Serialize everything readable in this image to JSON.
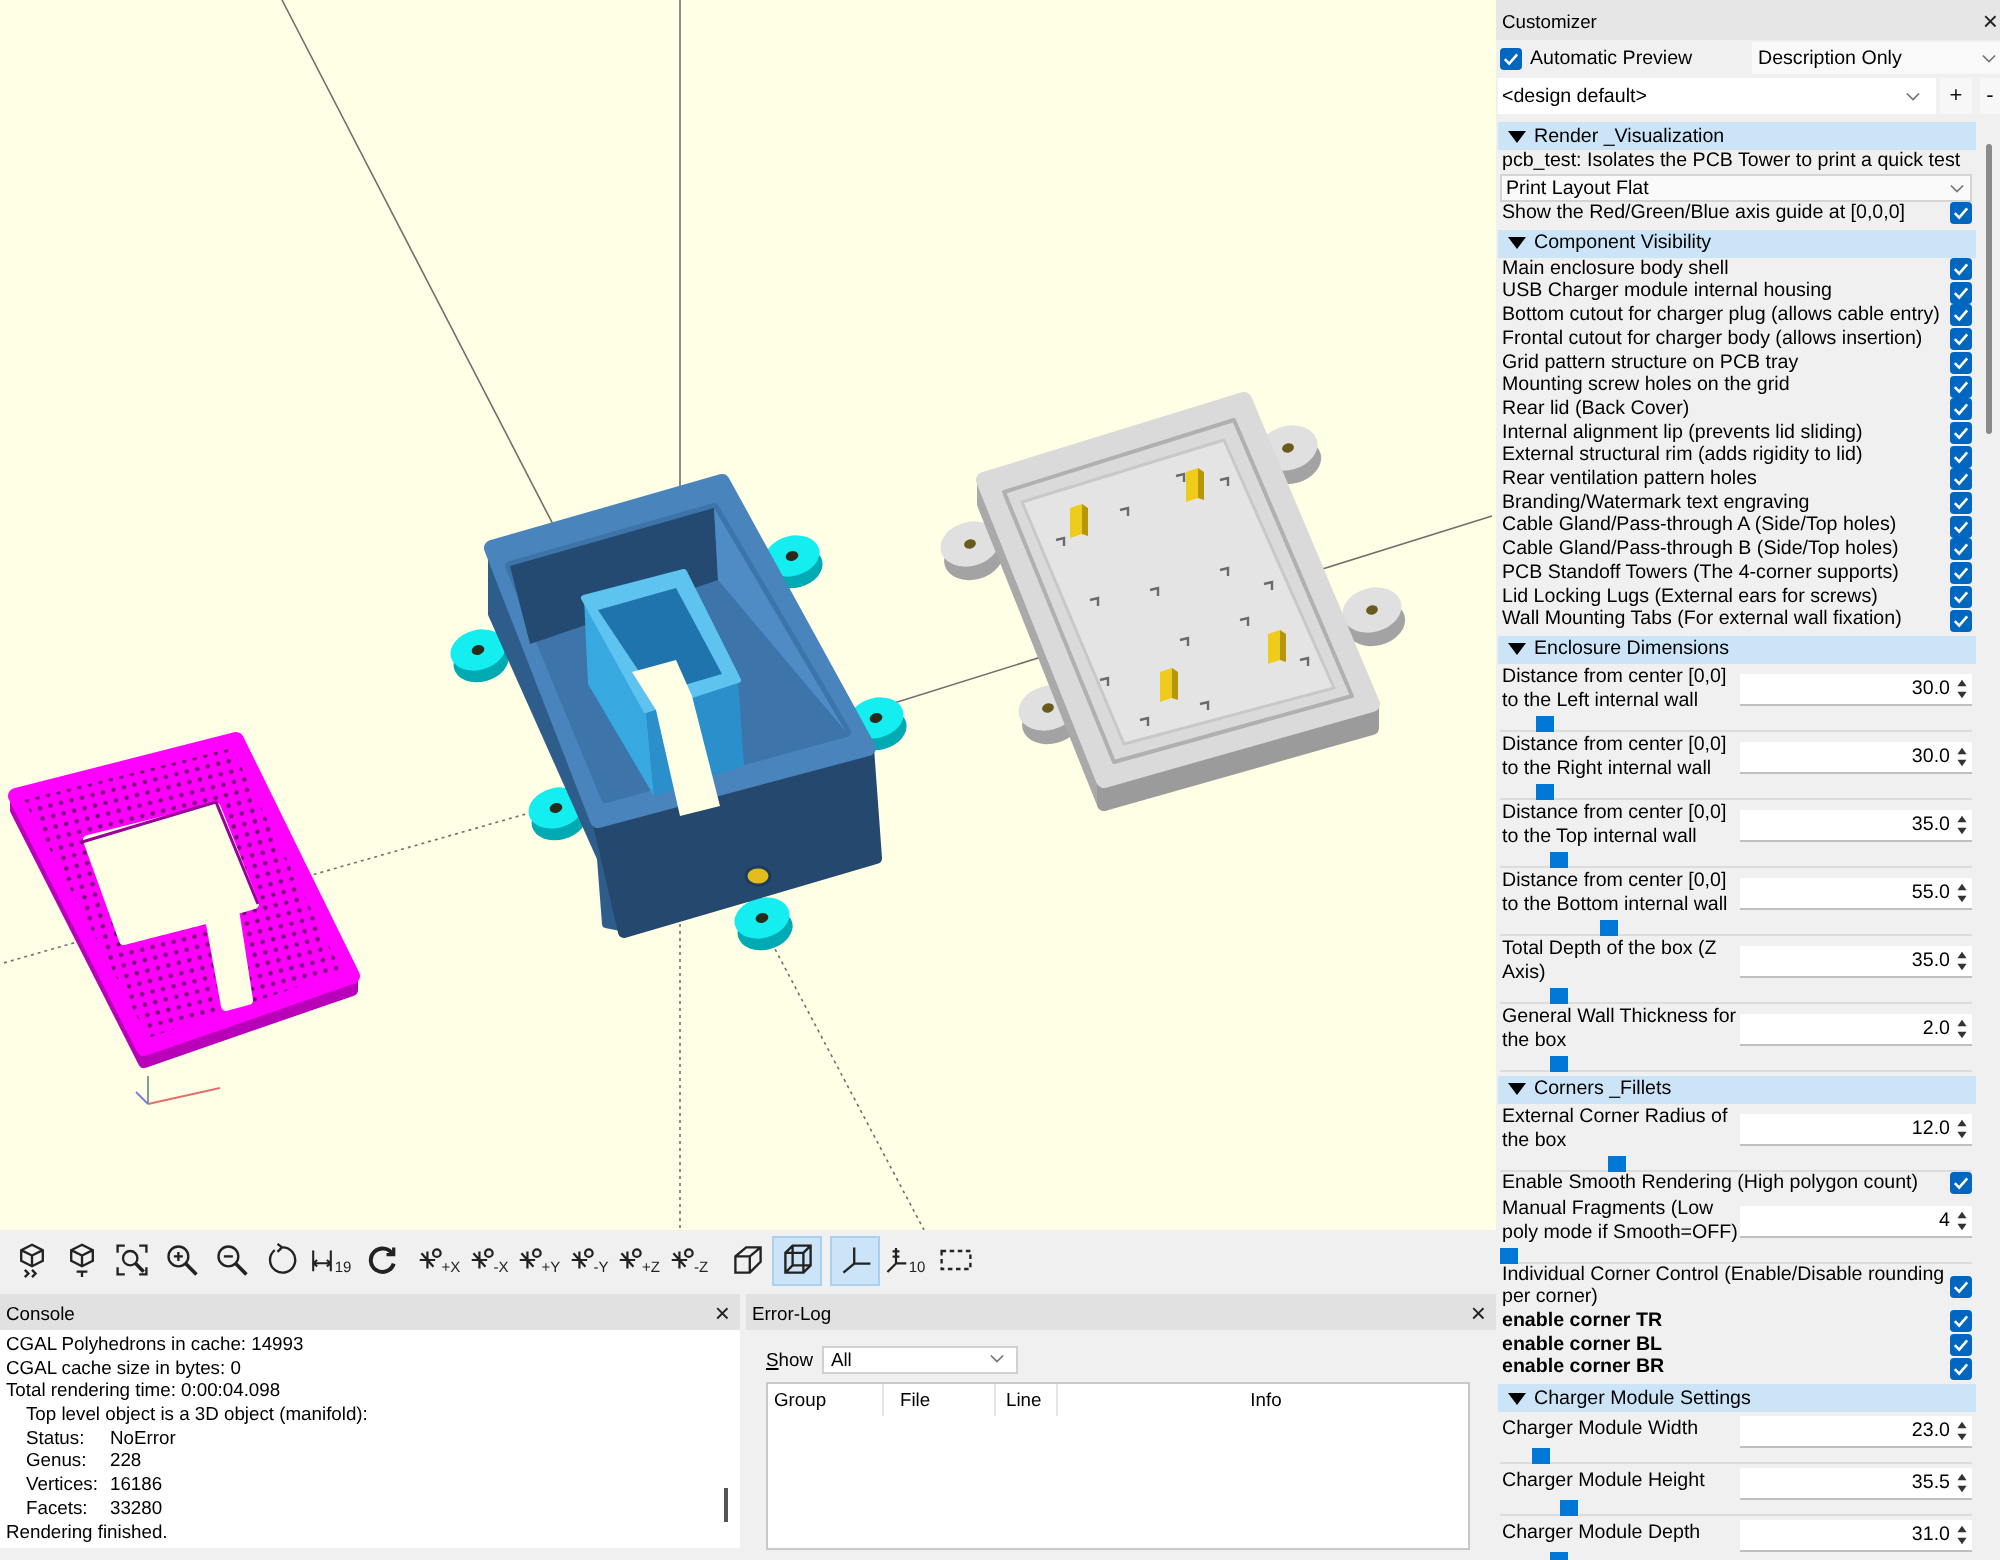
{
  "viewport": {
    "objects": [
      {
        "kind": "pcb-tray"
      },
      {
        "kind": "enclosure"
      },
      {
        "kind": "lid"
      }
    ]
  },
  "toolbar": {
    "groups": [
      [
        {
          "kind": "view-all",
          "selected": false
        },
        {
          "kind": "reset-view",
          "selected": false
        },
        {
          "kind": "zoom-all",
          "selected": false
        },
        {
          "kind": "zoom-in",
          "selected": false
        },
        {
          "kind": "zoom-out",
          "selected": false
        },
        {
          "kind": "reset-rotation",
          "selected": false
        },
        {
          "kind": "measure",
          "label": "19",
          "selected": false
        },
        {
          "kind": "rotate-45",
          "selected": false
        }
      ],
      [
        {
          "kind": "axis-view",
          "label": "+X",
          "selected": false
        },
        {
          "kind": "axis-view",
          "label": "-X",
          "selected": false
        },
        {
          "kind": "axis-view",
          "label": "+Y",
          "selected": false
        },
        {
          "kind": "axis-view",
          "label": "-Y",
          "selected": false
        },
        {
          "kind": "axis-view",
          "label": "+Z",
          "selected": false
        },
        {
          "kind": "axis-view",
          "label": "-Z",
          "selected": false
        }
      ],
      [
        {
          "kind": "perspective",
          "selected": false
        },
        {
          "kind": "orthogonal",
          "selected": true
        }
      ],
      [
        {
          "kind": "show-axes",
          "selected": true
        },
        {
          "kind": "scale-markers",
          "label": "10",
          "selected": false
        },
        {
          "kind": "show-edges",
          "selected": false
        }
      ]
    ]
  },
  "console": {
    "title": "Console",
    "close": "×",
    "lines": [
      {
        "kind": "plain",
        "text": "CGAL Polyhedrons in cache: 14993"
      },
      {
        "kind": "plain",
        "text": "CGAL cache size in bytes: 0"
      },
      {
        "kind": "plain",
        "text": "Total rendering time: 0:00:04.098"
      },
      {
        "kind": "indented",
        "text": "Top level object is a 3D object (manifold):"
      },
      {
        "kind": "stat",
        "label": "Status:",
        "value": "NoError"
      },
      {
        "kind": "stat",
        "label": "Genus:",
        "value": "228"
      },
      {
        "kind": "stat",
        "label": "Vertices:",
        "value": "16186"
      },
      {
        "kind": "stat",
        "label": "Facets:",
        "value": "33280"
      },
      {
        "kind": "plain",
        "text": "Rendering finished."
      }
    ]
  },
  "error_log": {
    "title": "Error-Log",
    "close": "×",
    "filter_label": "Show",
    "filter": "All",
    "columns": [
      "Group",
      "File",
      "Line",
      "Info"
    ]
  },
  "customizer": {
    "title": "Customizer",
    "close": "×",
    "automatic_preview": {
      "label": "Automatic Preview",
      "checked": true
    },
    "description_mode": "Description Only",
    "preset": "<design default>",
    "add": "+",
    "remove": "-",
    "sections": [
      {
        "title": "Render _Visualization",
        "expanded": true,
        "params": [
          {
            "kind": "dropdown",
            "label": "pcb_test: Isolates the PCB Tower to print a quick test",
            "value": "Print Layout Flat"
          },
          {
            "kind": "checkbox",
            "label": "Show the Red/Green/Blue axis guide at [0,0,0]",
            "checked": true
          }
        ]
      },
      {
        "title": "Component Visibility",
        "expanded": true,
        "params": [
          {
            "kind": "checkbox",
            "label": "Main enclosure body shell",
            "checked": true
          },
          {
            "kind": "checkbox",
            "label": "USB Charger module internal housing",
            "checked": true
          },
          {
            "kind": "checkbox",
            "label": "Bottom cutout for charger plug (allows cable entry)",
            "checked": true
          },
          {
            "kind": "checkbox",
            "label": "Frontal cutout for charger body (allows insertion)",
            "checked": true
          },
          {
            "kind": "checkbox",
            "label": "Grid pattern structure on PCB tray",
            "checked": true
          },
          {
            "kind": "checkbox",
            "label": "Mounting screw holes on the grid",
            "checked": true
          },
          {
            "kind": "checkbox",
            "label": "Rear lid (Back Cover)",
            "checked": true
          },
          {
            "kind": "checkbox",
            "label": "Internal alignment lip (prevents lid sliding)",
            "checked": true
          },
          {
            "kind": "checkbox",
            "label": "External structural rim (adds rigidity to lid)",
            "checked": true
          },
          {
            "kind": "checkbox",
            "label": "Rear ventilation pattern holes",
            "checked": true
          },
          {
            "kind": "checkbox",
            "label": "Branding/Watermark text engraving",
            "checked": true
          },
          {
            "kind": "checkbox",
            "label": "Cable Gland/Pass-through A (Side/Top holes)",
            "checked": true
          },
          {
            "kind": "checkbox",
            "label": "Cable Gland/Pass-through B (Side/Top holes)",
            "checked": true
          },
          {
            "kind": "checkbox",
            "label": "PCB Standoff Towers (The 4-corner supports)",
            "checked": true
          },
          {
            "kind": "checkbox",
            "label": "Lid Locking Lugs (External ears for screws)",
            "checked": true
          },
          {
            "kind": "checkbox",
            "label": "Wall Mounting Tabs (For external wall fixation)",
            "checked": true
          }
        ]
      },
      {
        "title": "Enclosure Dimensions",
        "expanded": true,
        "params": [
          {
            "kind": "number",
            "label": "Distance from center [0,0] to the Left internal wall",
            "value": "30.0",
            "level": 0.08
          },
          {
            "kind": "number",
            "label": "Distance from center [0,0] to the Right internal wall",
            "value": "30.0",
            "level": 0.08
          },
          {
            "kind": "number",
            "label": "Distance from center [0,0] to the Top internal wall",
            "value": "35.0",
            "level": 0.11
          },
          {
            "kind": "number",
            "label": "Distance from center [0,0] to the Bottom internal wall",
            "value": "55.0",
            "level": 0.22
          },
          {
            "kind": "number",
            "label": "Total Depth of the box (Z Axis)",
            "value": "35.0",
            "level": 0.11
          },
          {
            "kind": "number",
            "label": "General Wall Thickness for the box",
            "value": "2.0",
            "level": 0.11
          }
        ]
      },
      {
        "title": "Corners _Fillets",
        "expanded": true,
        "params": [
          {
            "kind": "number",
            "label": "External Corner Radius of the box",
            "value": "12.0",
            "level": 0.24
          },
          {
            "kind": "checkbox",
            "label": "Enable Smooth Rendering (High polygon count)",
            "checked": true
          },
          {
            "kind": "number",
            "label": "Manual Fragments (Low poly mode if Smooth=OFF)",
            "value": "4",
            "level": 0
          },
          {
            "kind": "checkbox",
            "label": "Individual Corner Control (Enable/Disable rounding per corner)",
            "checked": true
          },
          {
            "kind": "checkbox",
            "label": "enable corner TR",
            "checked": true,
            "bold": true
          },
          {
            "kind": "checkbox",
            "label": "enable corner BL",
            "checked": true,
            "bold": true
          },
          {
            "kind": "checkbox",
            "label": "enable corner BR",
            "checked": true,
            "bold": true
          }
        ]
      },
      {
        "title": "Charger Module Settings",
        "expanded": true,
        "params": [
          {
            "kind": "number",
            "label": "Charger Module Width",
            "value": "23.0",
            "level": 0.07
          },
          {
            "kind": "number",
            "label": "Charger Module Height",
            "value": "35.5",
            "level": 0.13
          },
          {
            "kind": "number",
            "label": "Charger Module Depth",
            "value": "31.0",
            "level": 0.11
          }
        ]
      }
    ]
  }
}
